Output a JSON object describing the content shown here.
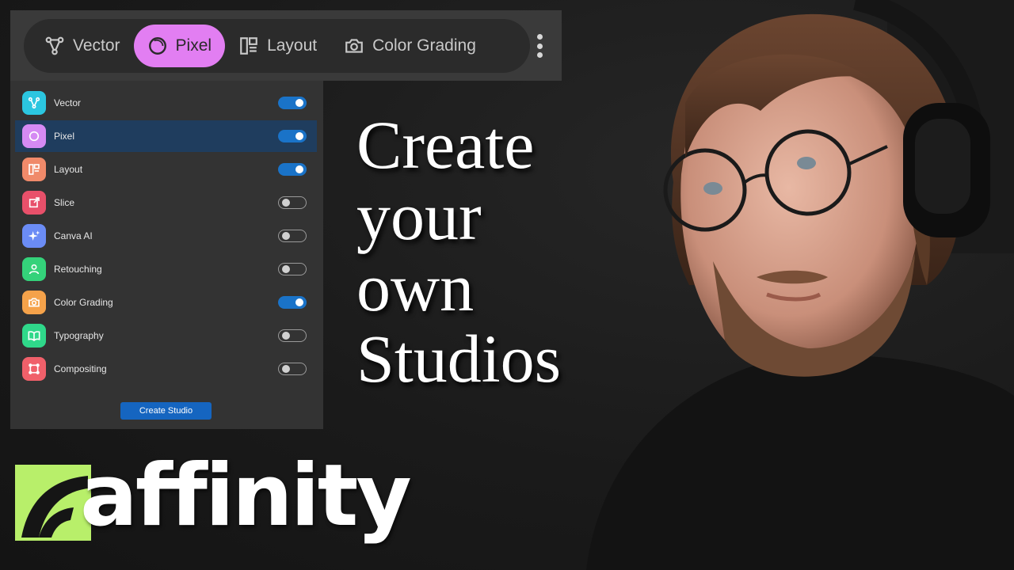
{
  "studio_bar": {
    "tabs": [
      {
        "label": "Vector",
        "icon": "vector-icon",
        "active": false
      },
      {
        "label": "Pixel",
        "icon": "pixel-icon",
        "active": true
      },
      {
        "label": "Layout",
        "icon": "layout-icon",
        "active": false
      },
      {
        "label": "Color Grading",
        "icon": "camera-icon",
        "active": false
      }
    ],
    "active_color": "#e27ef2"
  },
  "studio_list": {
    "items": [
      {
        "label": "Vector",
        "color": "#2bc6e0",
        "icon": "vector-icon",
        "enabled": true
      },
      {
        "label": "Pixel",
        "color": "#d58af3",
        "icon": "pixel-icon",
        "enabled": true
      },
      {
        "label": "Layout",
        "color": "#f08a6a",
        "icon": "layout-icon",
        "enabled": true
      },
      {
        "label": "Slice",
        "color": "#e8506a",
        "icon": "slice-icon",
        "enabled": false
      },
      {
        "label": "Canva AI",
        "color": "#6b8cf5",
        "icon": "sparkle-icon",
        "enabled": false
      },
      {
        "label": "Retouching",
        "color": "#34d27a",
        "icon": "person-icon",
        "enabled": false
      },
      {
        "label": "Color Grading",
        "color": "#f5a24a",
        "icon": "camera-icon",
        "enabled": true
      },
      {
        "label": "Typography",
        "color": "#2fd88a",
        "icon": "book-icon",
        "enabled": false
      },
      {
        "label": "Compositing",
        "color": "#f0606a",
        "icon": "compositing-icon",
        "enabled": false
      }
    ],
    "selected": "Pixel",
    "create_button": "Create Studio"
  },
  "headline": {
    "line1": "Create",
    "line2": "your",
    "line3": "own",
    "line4": "Studios"
  },
  "logo": {
    "text": "affinity",
    "mark_color": "#b8ef6a"
  }
}
